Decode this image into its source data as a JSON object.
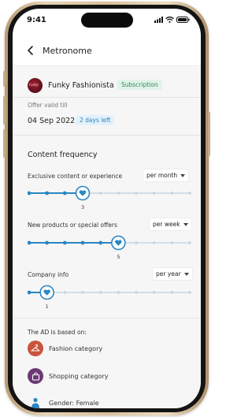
{
  "status": {
    "time": "9:41"
  },
  "header": {
    "title": "Metronome"
  },
  "brand": {
    "name": "Funky Fashionista",
    "badge": "Subscription",
    "logo_text": "Funky"
  },
  "offer": {
    "label": "Offer valid till",
    "date": "04 Sep 2022",
    "days_left": "2 days left"
  },
  "frequency": {
    "title": "Content frequency",
    "items": [
      {
        "label": "Exclusive content or experience",
        "period": "per month",
        "value": "3",
        "level": 3,
        "steps": 10
      },
      {
        "label": "New products or special offers",
        "period": "per week",
        "value": "5",
        "level": 5,
        "steps": 10
      },
      {
        "label": "Company info",
        "period": "per year",
        "value": "1",
        "level": 1,
        "steps": 10
      }
    ]
  },
  "ad_basis": {
    "title": "The AD is based on:",
    "items": [
      {
        "label": "Fashion category",
        "icon": "hanger-icon",
        "color": "#c8553d"
      },
      {
        "label": "Shopping category",
        "icon": "shopping-bag-icon",
        "color": "#6b3a73"
      },
      {
        "label": "Gender: Female",
        "icon": "person-icon",
        "color": "#2a86c2"
      }
    ]
  },
  "colors": {
    "accent": "#2a86c2",
    "track_inactive": "#c7d7e3"
  }
}
